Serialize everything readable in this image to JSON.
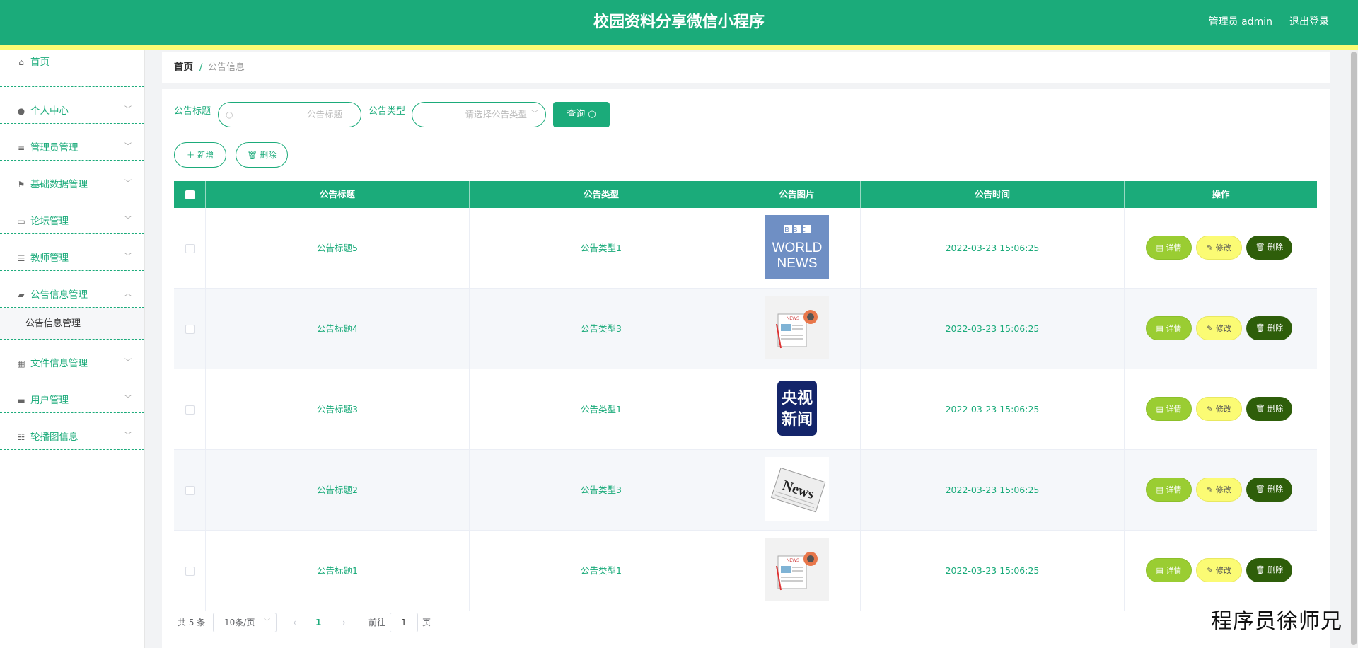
{
  "header": {
    "title": "校园资料分享微信小程序",
    "user_label": "管理员 admin",
    "logout_label": "退出登录"
  },
  "sidebar": {
    "items": [
      {
        "label": "首页",
        "icon": "home-icon",
        "glyph": "⌂",
        "arrow": ""
      },
      {
        "label": "个人中心",
        "icon": "user-icon",
        "glyph": "●",
        "arrow": "﹀"
      },
      {
        "label": "管理员管理",
        "icon": "list-icon",
        "glyph": "≡",
        "arrow": "﹀"
      },
      {
        "label": "基础数据管理",
        "icon": "flag-icon",
        "glyph": "⚑",
        "arrow": "﹀"
      },
      {
        "label": "论坛管理",
        "icon": "forum-icon",
        "glyph": "▭",
        "arrow": "﹀"
      },
      {
        "label": "教师管理",
        "icon": "menu-icon",
        "glyph": "☰",
        "arrow": "﹀"
      },
      {
        "label": "公告信息管理",
        "icon": "notice-icon",
        "glyph": "▰",
        "arrow": "︿"
      },
      {
        "label": "文件信息管理",
        "icon": "grid-icon",
        "glyph": "▦",
        "arrow": "﹀"
      },
      {
        "label": "用户管理",
        "icon": "monitor-icon",
        "glyph": "▬",
        "arrow": "﹀"
      },
      {
        "label": "轮播图信息",
        "icon": "sliders-icon",
        "glyph": "☷",
        "arrow": "﹀"
      }
    ],
    "submenu_label": "公告信息管理"
  },
  "breadcrumb": {
    "home": "首页",
    "separator": "/",
    "current": "公告信息"
  },
  "search": {
    "title_label": "公告标题",
    "title_placeholder": "公告标题",
    "type_label": "公告类型",
    "type_placeholder": "请选择公告类型",
    "query_label": "查询 ○"
  },
  "actions": {
    "add_label": "＋ 新增",
    "delete_label": "🗑 删除"
  },
  "table": {
    "headers": [
      "公告标题",
      "公告类型",
      "公告图片",
      "公告时间",
      "操作"
    ],
    "rows": [
      {
        "title": "公告标题5",
        "type": "公告类型1",
        "image": "bbc-world-news",
        "time": "2022-03-23 15:06:25"
      },
      {
        "title": "公告标题4",
        "type": "公告类型3",
        "image": "news-paper-mic",
        "time": "2022-03-23 15:06:25"
      },
      {
        "title": "公告标题3",
        "type": "公告类型1",
        "image": "cctv-news",
        "time": "2022-03-23 15:06:25"
      },
      {
        "title": "公告标题2",
        "type": "公告类型3",
        "image": "news-paper",
        "time": "2022-03-23 15:06:25"
      },
      {
        "title": "公告标题1",
        "type": "公告类型1",
        "image": "news-paper-mic",
        "time": "2022-03-23 15:06:25"
      }
    ],
    "row_actions": {
      "detail": "详情",
      "edit": "修改",
      "delete": "删除"
    }
  },
  "pagination": {
    "total": "共 5 条",
    "page_size": "10条/页",
    "current_page": "1",
    "goto_label": "前往",
    "goto_value": "1",
    "page_unit": "页"
  },
  "thumb_text": {
    "bbc": "BBC",
    "world": "WORLD",
    "news": "NEWS",
    "cctv_a": "央视",
    "cctv_b": "新闻",
    "paper_news": "News",
    "small_news": "NEWS"
  },
  "watermark": "程序员徐师兄",
  "colors": {
    "primary": "#1bab7a",
    "accent_yellow": "#fbfb74",
    "detail_btn": "#9acd32",
    "delete_btn": "#2e5e0a"
  }
}
